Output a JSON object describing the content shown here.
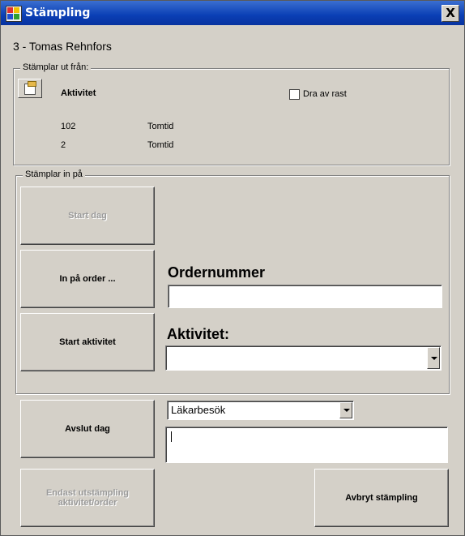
{
  "window": {
    "title": "Stämpling",
    "close_label": "X"
  },
  "user_heading": "3 - Tomas Rehnfors",
  "out_group": {
    "legend": "Stämplar ut från:",
    "column_header": "Aktivitet",
    "break_checkbox": {
      "label": "Dra av rast",
      "checked": false
    },
    "rows": [
      {
        "code": "102",
        "name": "Tomtid"
      },
      {
        "code": "2",
        "name": "Tomtid"
      }
    ]
  },
  "in_group": {
    "legend": "Stämplar in på",
    "start_day": "Start dag",
    "in_on_order": "In på order ...",
    "start_activity": "Start aktivitet",
    "order_label": "Ordernummer",
    "order_value": "",
    "activity_label": "Aktivitet:",
    "activity_value": ""
  },
  "bottom": {
    "end_day": "Avslut dag",
    "reason_value": "Läkarbesök",
    "comment_value": "",
    "only_checkout": "Endast utstämpling aktivitet/order",
    "cancel": "Avbryt stämpling"
  }
}
